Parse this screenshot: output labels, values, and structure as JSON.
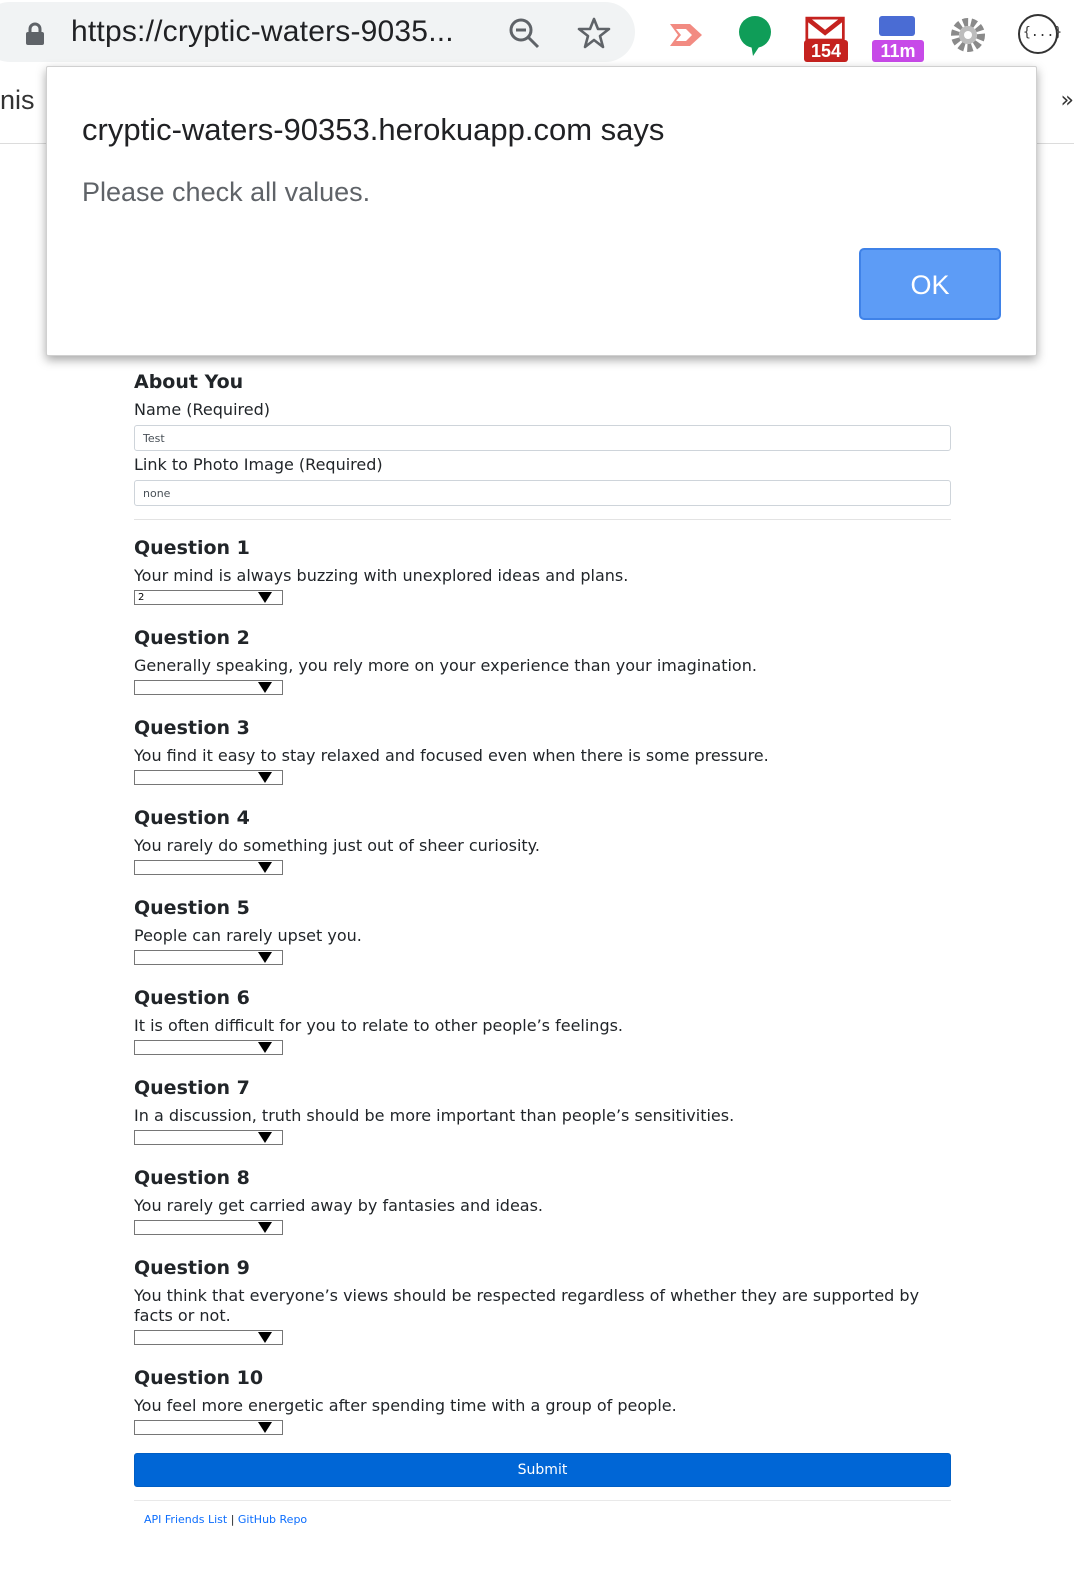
{
  "browser": {
    "url": "https://cryptic-waters-9035...",
    "extensions": {
      "gmail_badge": "154",
      "timer_badge": "11m",
      "json_label": "{...}"
    },
    "page_peek_left": "nis",
    "page_peek_right": "»"
  },
  "dialog": {
    "title": "cryptic-waters-90353.herokuapp.com says",
    "message": "Please check all values.",
    "ok_label": "OK"
  },
  "form": {
    "about_heading": "About You",
    "name_label": "Name (Required)",
    "name_value": "Test",
    "photo_label": "Link to Photo Image (Required)",
    "photo_value": "none",
    "questions": [
      {
        "title": "Question 1",
        "text": "Your mind is always buzzing with unexplored ideas and plans.",
        "selected": "2"
      },
      {
        "title": "Question 2",
        "text": "Generally speaking, you rely more on your experience than your imagination.",
        "selected": ""
      },
      {
        "title": "Question 3",
        "text": "You find it easy to stay relaxed and focused even when there is some pressure.",
        "selected": ""
      },
      {
        "title": "Question 4",
        "text": "You rarely do something just out of sheer curiosity.",
        "selected": ""
      },
      {
        "title": "Question 5",
        "text": "People can rarely upset you.",
        "selected": ""
      },
      {
        "title": "Question 6",
        "text": "It is often difficult for you to relate to other people’s feelings.",
        "selected": ""
      },
      {
        "title": "Question 7",
        "text": "In a discussion, truth should be more important than people’s sensitivities.",
        "selected": ""
      },
      {
        "title": "Question 8",
        "text": "You rarely get carried away by fantasies and ideas.",
        "selected": ""
      },
      {
        "title": "Question 9",
        "text": "You think that everyone’s views should be respected regardless of whether they are supported by facts or not.",
        "selected": ""
      },
      {
        "title": "Question 10",
        "text": "You feel more energetic after spending time with a group of people.",
        "selected": ""
      }
    ],
    "submit_label": "Submit"
  },
  "footer": {
    "api_link": "API Friends List",
    "separator": "|",
    "github_link": "GitHub Repo"
  },
  "colors": {
    "submit": "#0066d6",
    "ok_button": "#5d9cf6",
    "gmail_red": "#c5221f",
    "timer_purple": "#c74ae8"
  }
}
